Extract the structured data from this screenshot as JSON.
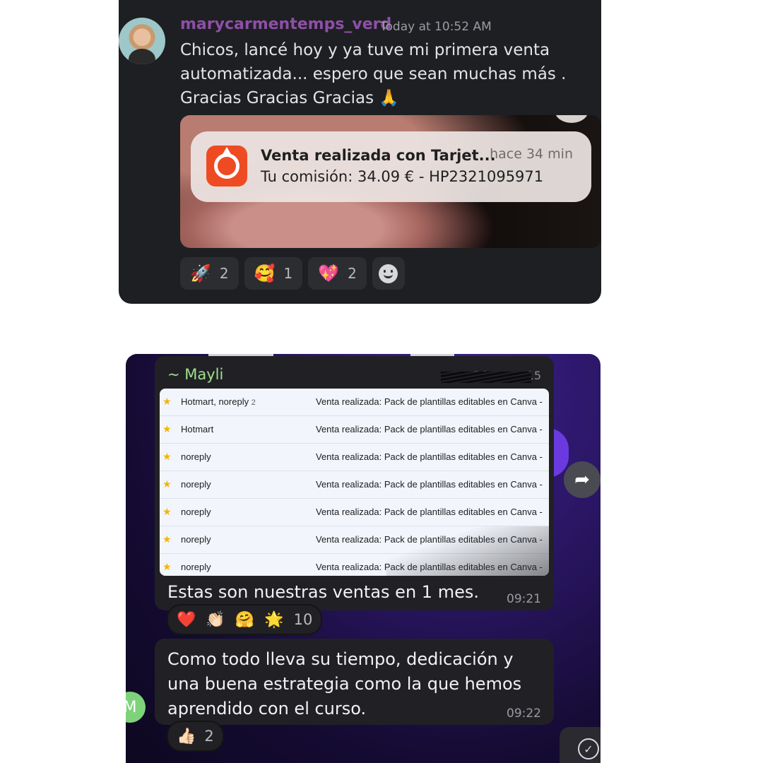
{
  "discord": {
    "username": "marycarmentemps_verd",
    "timestamp": "Today at 10:52 AM",
    "message": "Chicos, lancé hoy y ya tuve mi primera venta automatizada... espero que sean muchas más . Gracias Gracias Gracias 🙏",
    "notification": {
      "title": "Venta realizada con Tarjet...",
      "time": "hace 34 min",
      "body": "Tu comisión: 34.09 € - HP2321095971",
      "icon": "hotmart-flame-icon"
    },
    "reactions": [
      {
        "emoji": "🚀",
        "count": "2"
      },
      {
        "emoji": "🥰",
        "count": "1"
      },
      {
        "emoji": "💖",
        "count": "2"
      }
    ],
    "add_reaction_icon": "smiley-icon"
  },
  "telegram": {
    "sender": "~ Mayli",
    "phone": "+34 ··· ·· ·· 15",
    "emails": [
      {
        "from": "Hotmart, noreply",
        "count": "2",
        "subject": "Venta realizada: Pack de plantillas editables en Canva -"
      },
      {
        "from": "Hotmart",
        "count": "",
        "subject": "Venta realizada: Pack de plantillas editables en Canva -"
      },
      {
        "from": "noreply",
        "count": "",
        "subject": "Venta realizada: Pack de plantillas editables en Canva -"
      },
      {
        "from": "noreply",
        "count": "",
        "subject": "Venta realizada: Pack de plantillas editables en Canva -"
      },
      {
        "from": "noreply",
        "count": "",
        "subject": "Venta realizada: Pack de plantillas editables en Canva -"
      },
      {
        "from": "noreply",
        "count": "",
        "subject": "Venta realizada: Pack de plantillas editables en Canva -"
      },
      {
        "from": "noreply",
        "count": "",
        "subject": "Venta realizada: Pack de plantillas editables en Canva -"
      }
    ],
    "caption": "Estas son nuestras ventas en 1 mes.",
    "time1": "09:21",
    "reactions1": {
      "emojis": [
        "❤️",
        "👏🏻",
        "🤗",
        "🌟"
      ],
      "count": "10"
    },
    "message2": "Como todo lleva su tiempo, dedicación y una buena estrategia como la que hemos aprendido con el curso.",
    "time2": "09:22",
    "avatar_letter": "M",
    "reactions2": {
      "emoji": "👍🏻",
      "count": "2"
    },
    "share_icon": "share-arrow-icon",
    "scroll_icon": "scroll-down-icon"
  },
  "colors": {
    "discord_bg": "#1e1f22",
    "username": "#8e4fa8",
    "telegram_sender": "#9fe08a",
    "hotmart_orange": "#ef4b23"
  }
}
